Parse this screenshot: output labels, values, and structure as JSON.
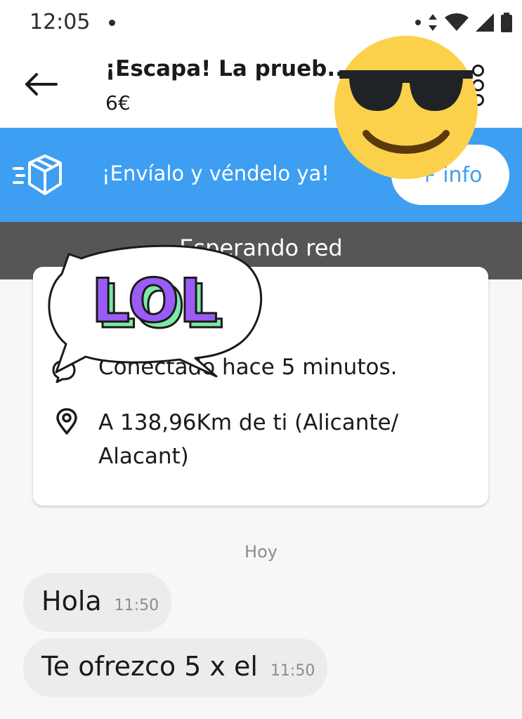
{
  "status_bar": {
    "time": "12:05"
  },
  "header": {
    "title": "¡Escapa! La prueb...",
    "price": "6€"
  },
  "banner": {
    "text": "¡Envíalo y véndelo ya!",
    "button_label": "+ info"
  },
  "network": {
    "text": "Esperando red"
  },
  "card": {
    "connection": "Conectado hace 5 minutos.",
    "location": "A 138,96Km de ti (Alicante/ Alacant)"
  },
  "chat": {
    "day_label": "Hoy",
    "messages": [
      {
        "text": "Hola",
        "time": "11:50"
      },
      {
        "text": "Te ofrezco 5 x el",
        "time": "11:50"
      }
    ]
  },
  "stickers": {
    "lol_text": "LOL",
    "emoji": "smiling face with sunglasses"
  },
  "colors": {
    "banner": "#3d9ef2",
    "network_bar": "#565656",
    "bubble": "#ececec",
    "emoji_yellow": "#fbd14b",
    "lol_purple": "#9b5cf5",
    "lol_green": "#7ee8a6"
  }
}
